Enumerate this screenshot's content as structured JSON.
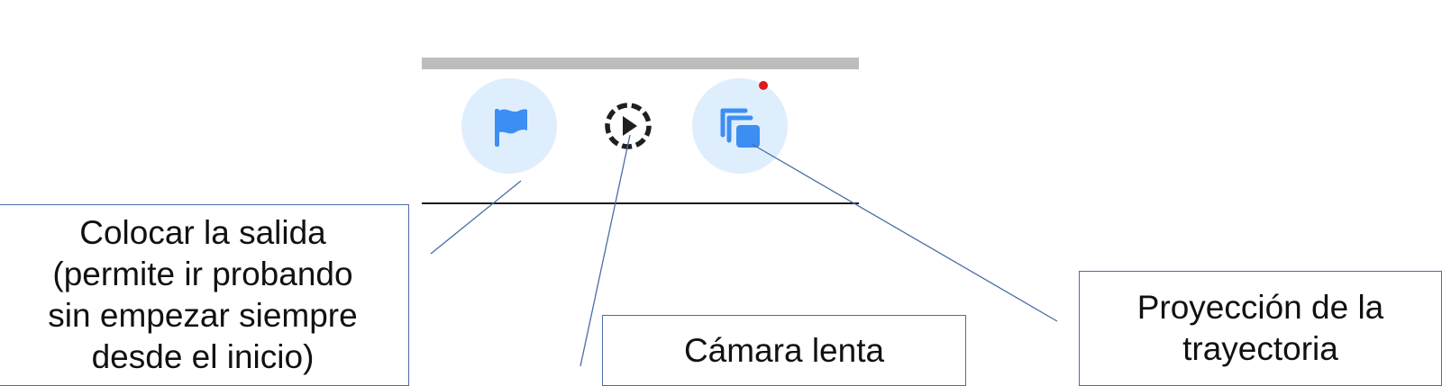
{
  "toolbar": {
    "buttons": [
      {
        "id": "start",
        "icon": "flag-icon",
        "style": "filled"
      },
      {
        "id": "slow_motion",
        "icon": "slow-motion-play-icon",
        "style": "plain"
      },
      {
        "id": "projection",
        "icon": "layers-icon",
        "style": "filled",
        "badge": "notification-dot"
      }
    ],
    "colors": {
      "icon_blue": "#3d8ef3",
      "button_bg": "#dfeefd",
      "badge_red": "#e0191e",
      "top_bar": "#bdbdbd"
    }
  },
  "callouts": {
    "start": "Colocar la salida\n(permite ir probando\nsin empezar siempre\ndesde el inicio)",
    "slow_motion": "Cámara lenta",
    "projection": "Proyección de la\ntrayectoria"
  }
}
